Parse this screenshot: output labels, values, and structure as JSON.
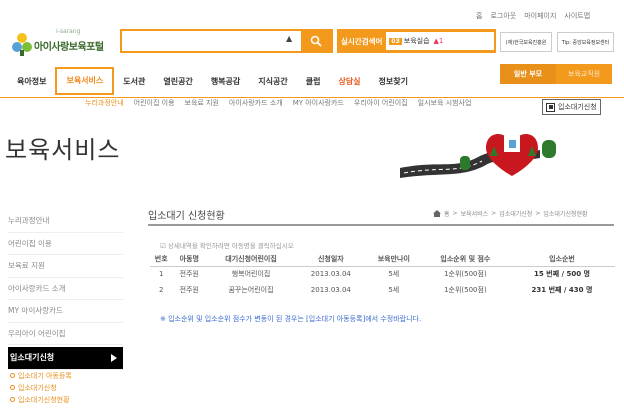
{
  "util": [
    "홈",
    "로그아웃",
    "마이페이지",
    "사이트맵"
  ],
  "logo": {
    "sub": "i-sarang",
    "main": "아이사랑보육포털"
  },
  "search": {
    "placeholder": "",
    "arrow": "▲"
  },
  "realtime": {
    "label": "실시간검색어",
    "badge": "03",
    "term": "보육실습",
    "change": "▲1"
  },
  "banners": [
    "(재)한국보육진흥원",
    "Tip: 중앙보육정보센터"
  ],
  "nav": [
    {
      "label": "육아정보"
    },
    {
      "label": "보육서비스"
    },
    {
      "label": "도서관"
    },
    {
      "label": "열린공간"
    },
    {
      "label": "행복공감"
    },
    {
      "label": "지식공간"
    },
    {
      "label": "클럽"
    },
    {
      "label": "상담실"
    },
    {
      "label": "정보찾기"
    }
  ],
  "member": {
    "a": "일반 부모",
    "b": "보육교직원"
  },
  "subnav": [
    "누리과정안내",
    "어린이집 이용",
    "보육료 지원",
    "아이사랑카드 소개",
    "MY 아이사랑카드",
    "우리아이 어린이집",
    "일시보육 시범사업"
  ],
  "wait_button": "입소대기신청",
  "hero_title": "보육서비스",
  "left_menu": [
    "누리과정안내",
    "어린이집 이용",
    "보육료 지원",
    "아이사랑카드 소개",
    "MY 아이사랑카드",
    "우리아이 어린이집"
  ],
  "left_active": "입소대기신청",
  "left_sub": [
    "입소대기 아동등록",
    "입소대기신청",
    "입소대기신청현황"
  ],
  "content": {
    "title": "입소대기 신청현황",
    "breadcrumb": [
      "홈",
      "보육서비스",
      "입소대기신청",
      "입소대기신청현황"
    ],
    "notice": "상세내역을 확인하려면 아동명을 클릭하십시오",
    "columns": [
      "번호",
      "아동명",
      "대기신청어린이집",
      "신청일자",
      "보육만나이",
      "입소순위 및 점수",
      "입소순번"
    ],
    "rows": [
      [
        "1",
        "전주원",
        "행복어린이집",
        "2013.03.04",
        "5세",
        "1순위(500점)",
        "15 번째 / 500 명"
      ],
      [
        "2",
        "전주원",
        "꿈꾸는어린이집",
        "2013.03.04",
        "5세",
        "1순위(500점)",
        "231 번째 / 430 명"
      ]
    ],
    "note": "※ 입소순위 및 입소순위 점수가 변동이 된 경우는 [입소대기 아동등록]에서 수정바랍니다."
  },
  "colors": {
    "accent": "#f39a1d",
    "note": "#3a6bd0"
  }
}
